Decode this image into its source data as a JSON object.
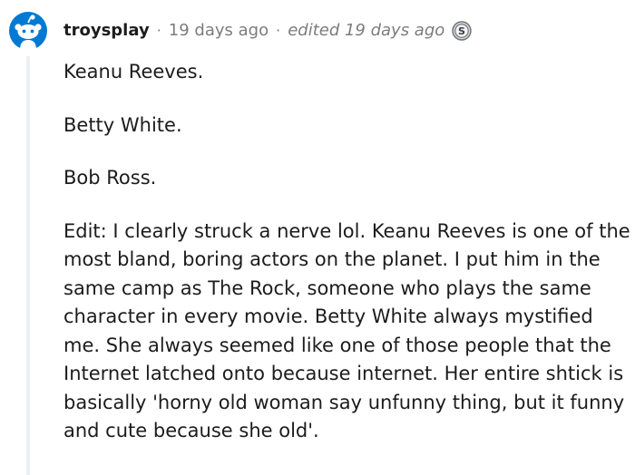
{
  "comment": {
    "author": "troysplay",
    "separator": "·",
    "time_ago": "19 days ago",
    "edited": "edited 19 days ago",
    "award_icon": "silver-coin-award-icon",
    "avatar_icon": "snoo-avatar-icon",
    "paragraphs": [
      "Keanu Reeves.",
      "Betty White.",
      "Bob Ross.",
      "Edit: I clearly struck a nerve lol. Keanu Reeves is one of the most bland, boring actors on the planet. I put him in the same camp as The Rock, someone who plays the same character in every movie. Betty White always mystified me. She always seemed like one of those people that the Internet latched onto because internet. Her entire shtick is basically 'horny old woman say unfunny thing, but it funny and cute because she old'."
    ]
  },
  "colors": {
    "text": "#1c1c1c",
    "meta": "#7c7c7c",
    "avatar_bg": "#0079d3",
    "thread_line": "#eeeff1"
  }
}
